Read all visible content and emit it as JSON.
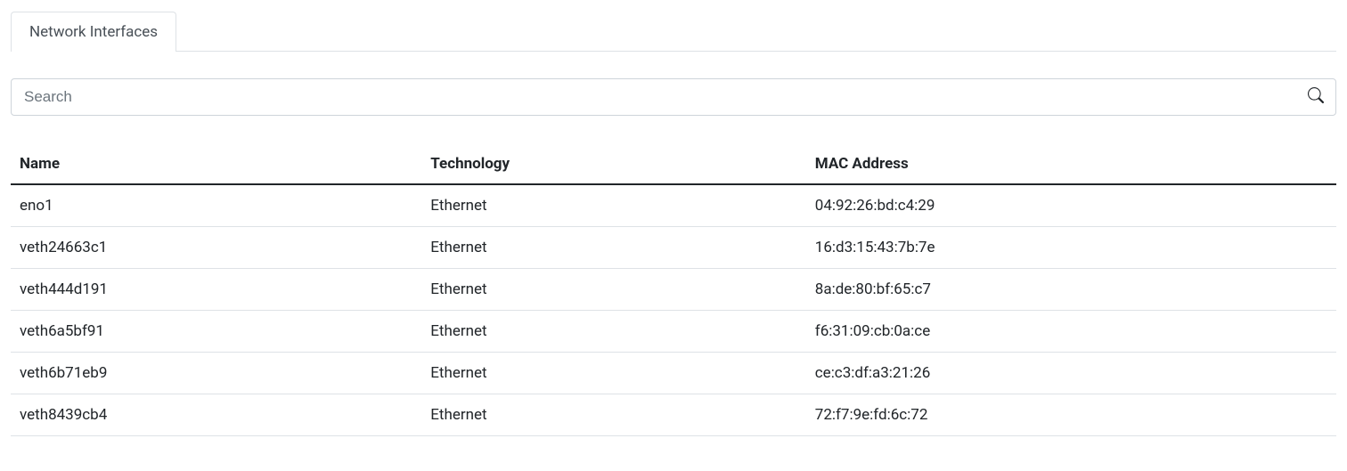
{
  "tabs": [
    {
      "label": "Network Interfaces"
    }
  ],
  "search": {
    "placeholder": "Search",
    "value": ""
  },
  "table": {
    "columns": [
      "Name",
      "Technology",
      "MAC Address"
    ],
    "rows": [
      {
        "name": "eno1",
        "technology": "Ethernet",
        "mac": "04:92:26:bd:c4:29"
      },
      {
        "name": "veth24663c1",
        "technology": "Ethernet",
        "mac": "16:d3:15:43:7b:7e"
      },
      {
        "name": "veth444d191",
        "technology": "Ethernet",
        "mac": "8a:de:80:bf:65:c7"
      },
      {
        "name": "veth6a5bf91",
        "technology": "Ethernet",
        "mac": "f6:31:09:cb:0a:ce"
      },
      {
        "name": "veth6b71eb9",
        "technology": "Ethernet",
        "mac": "ce:c3:df:a3:21:26"
      },
      {
        "name": "veth8439cb4",
        "technology": "Ethernet",
        "mac": "72:f7:9e:fd:6c:72"
      }
    ]
  }
}
